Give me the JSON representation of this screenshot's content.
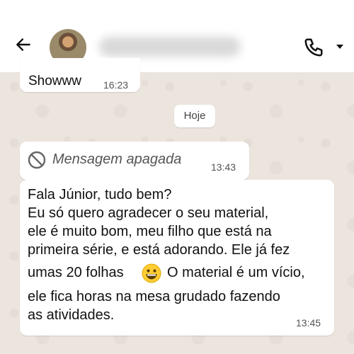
{
  "header": {
    "back_icon": "arrow-left-icon",
    "call_icon": "phone-icon",
    "menu_icon": "caret-down-icon"
  },
  "messages": [
    {
      "text": "Showww",
      "time": "16:23"
    },
    {
      "text": "Mensagem apagada",
      "time": "13:43",
      "icon": "blocked-icon"
    },
    {
      "lines": [
        "Fala Júnior, tudo bem?",
        "Eu só quero agradecer o seu material,",
        "ele é muito bom, meu filho que está na",
        "primeira série, e está adorando. Ele já fez",
        "umas 20 folhas",
        "O material é um vício,",
        "ele fica horas na mesa grudado fazendo",
        "as atividades."
      ],
      "emoji": "grinning-face-icon",
      "time": "13:45"
    }
  ],
  "date_separator": "Hoje",
  "colors": {
    "header_bg": "#ffffff",
    "chat_bg": "#ece5dd",
    "bubble_bg": "#ffffff"
  }
}
